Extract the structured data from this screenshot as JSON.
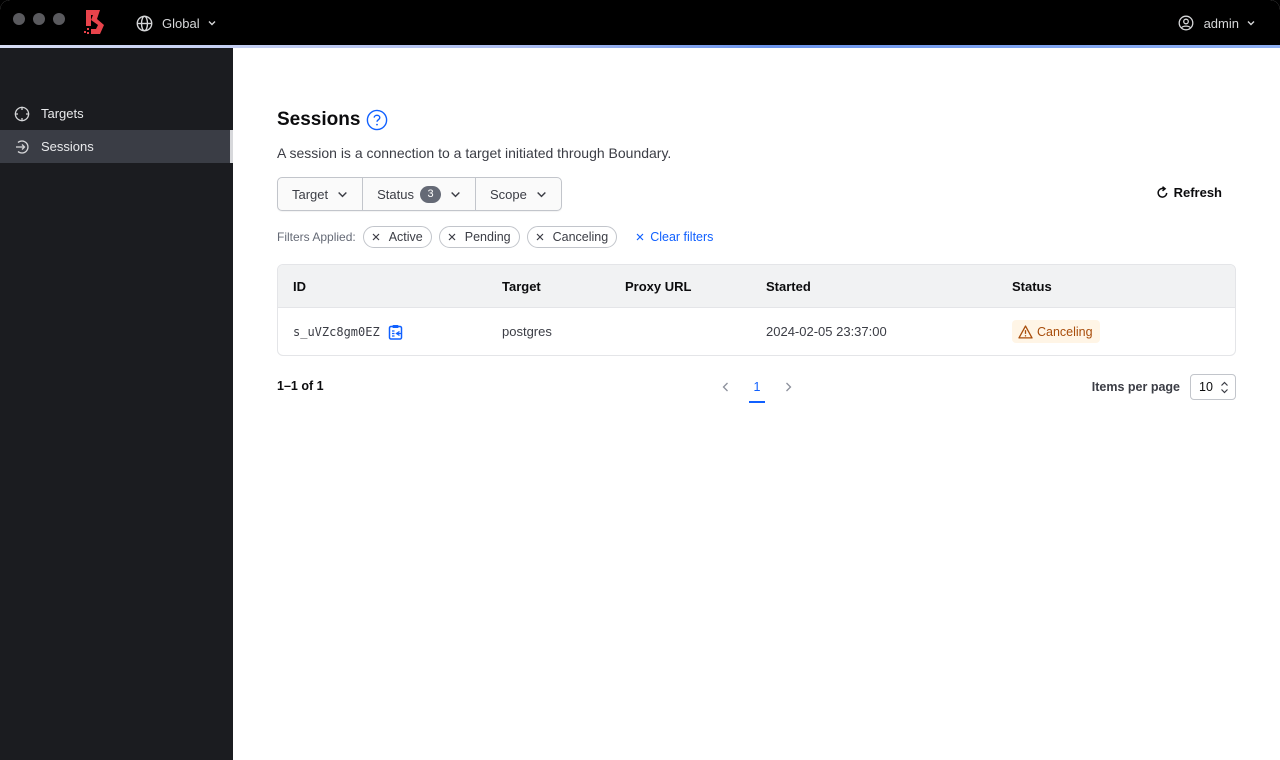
{
  "header": {
    "scope_label": "Global",
    "user_label": "admin",
    "brand_color": "#e8434b"
  },
  "sidebar": {
    "items": [
      {
        "label": "Targets",
        "icon": "target-icon",
        "active": false
      },
      {
        "label": "Sessions",
        "icon": "sessions-icon",
        "active": true
      }
    ]
  },
  "page": {
    "title": "Sessions",
    "description": "A session is a connection to a target initiated through Boundary."
  },
  "filters": {
    "target_label": "Target",
    "status_label": "Status",
    "status_count": "3",
    "scope_label": "Scope",
    "refresh_label": "Refresh",
    "applied_label": "Filters Applied:",
    "applied": [
      "Active",
      "Pending",
      "Canceling"
    ],
    "clear_label": "Clear filters"
  },
  "table": {
    "columns": [
      "ID",
      "Target",
      "Proxy URL",
      "Started",
      "Status"
    ],
    "rows": [
      {
        "id": "s_uVZc8gm0EZ",
        "target": "postgres",
        "proxy_url": "",
        "started": "2024-02-05 23:37:00",
        "status": "Canceling",
        "status_color": "#a84d0b"
      }
    ]
  },
  "pagination": {
    "summary": "1–1 of 1",
    "current_page": "1",
    "items_per_page_label": "Items per page",
    "items_per_page": "10"
  }
}
